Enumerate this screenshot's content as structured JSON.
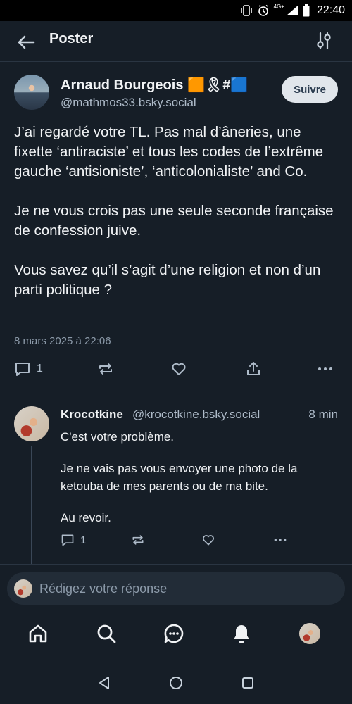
{
  "status_bar": {
    "network": "4G+",
    "time": "22:40"
  },
  "header": {
    "title": "Poster",
    "icons": {
      "back": "arrow-left-icon",
      "filter": "sliders-icon"
    }
  },
  "post": {
    "author_name": "Arnaud Bourgeois 🟧🎗#🟦",
    "author_handle": "@mathmos33.bsky.social",
    "follow_label": "Suivre",
    "paragraphs": [
      "J’ai regardé votre TL. Pas mal d’âneries, une fixette ‘antiraciste’ et tous les codes de l’extrême gauche ‘antisioniste’, ‘anticolonialiste’ and Co.",
      "Je ne vous crois pas une seule seconde française de confession juive.",
      "Vous savez qu’il s’agit d’une religion et non d’un parti politique ?"
    ],
    "date": "8 mars 2025 à 22:06",
    "reply_count": "1"
  },
  "reply": {
    "author_name": "Krocotkine",
    "author_handle": "@krocotkine.bsky.social",
    "time": "8 min",
    "paragraphs": [
      "C'est votre problème.",
      "Je ne vais pas vous envoyer une photo de la ketouba de mes parents ou de ma bite.",
      "Au revoir."
    ],
    "reply_count": "1"
  },
  "composer": {
    "placeholder": "Rédigez votre réponse"
  },
  "colors": {
    "background": "#161e27",
    "follow_button": "#e1e6eb",
    "muted": "#aebbc9"
  }
}
